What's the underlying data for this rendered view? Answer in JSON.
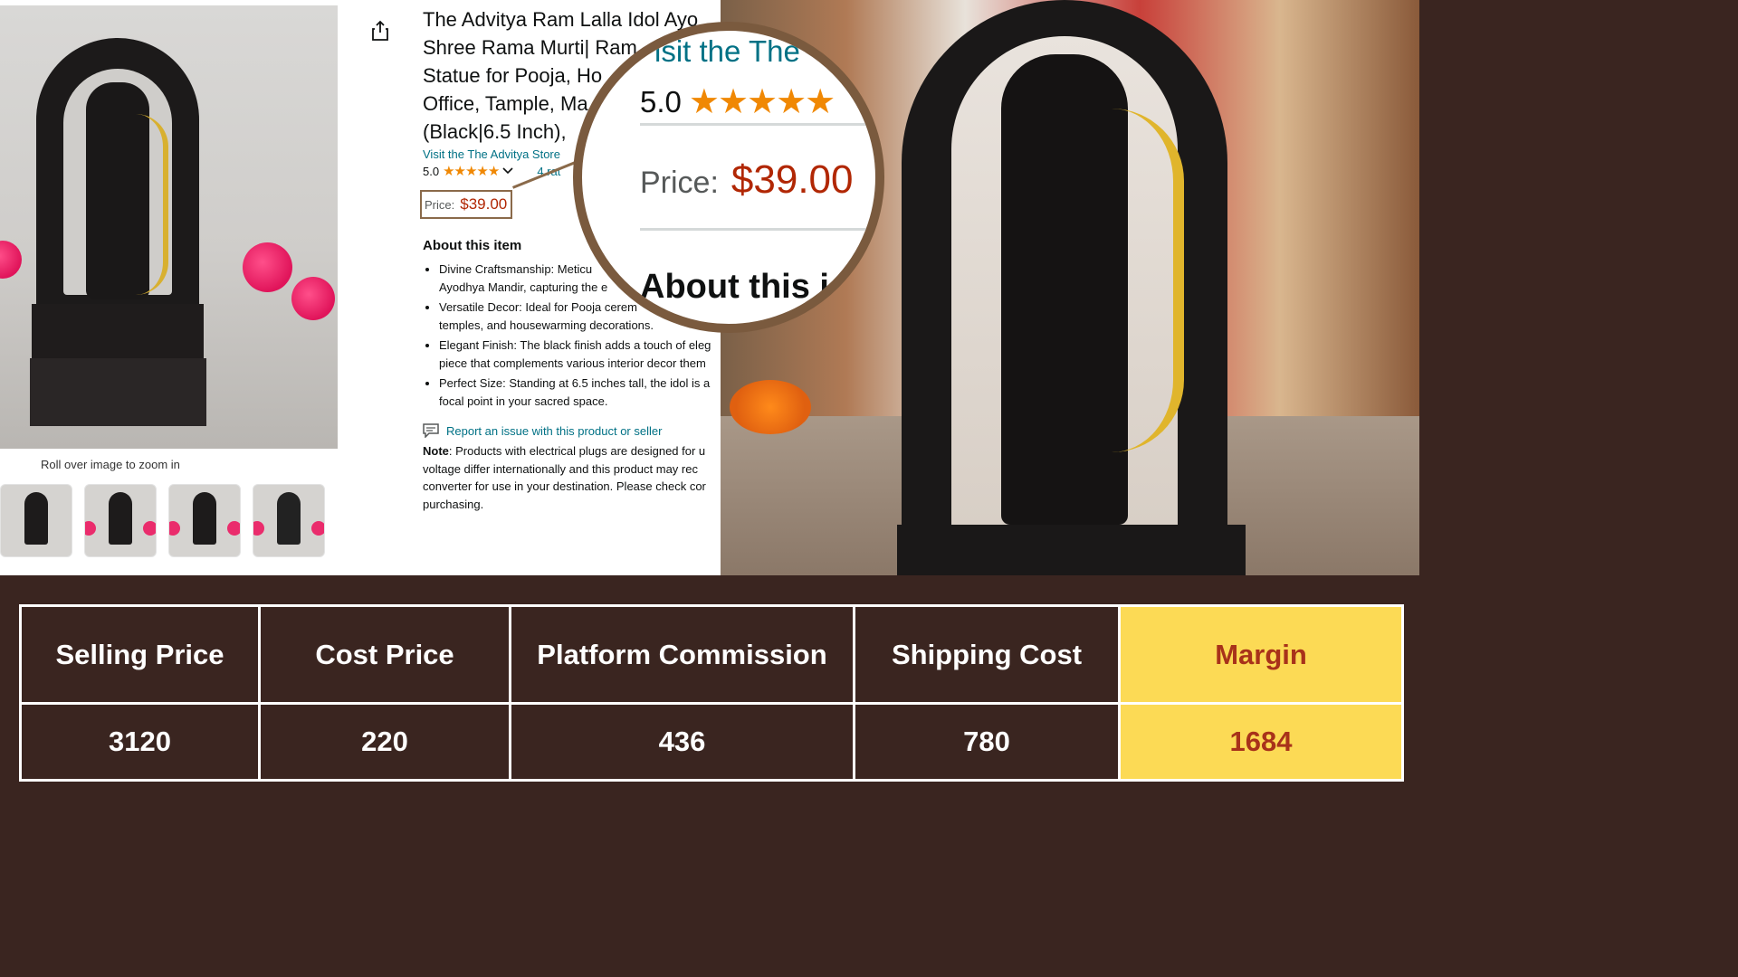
{
  "product": {
    "title_lines": [
      "The Advitya Ram Lalla Idol Ayo",
      "Shree Rama Murti| Ram",
      "Statue for Pooja, Ho",
      "Office, Tample, Ma",
      "(Black|6.5 Inch),"
    ],
    "store_link": "Visit the The Advitya Store",
    "rating": "5.0",
    "stars": "★★★★★",
    "ratings_count": "4 rat",
    "price_label": "Price:",
    "price": "$39.00",
    "about_title": "About this item",
    "bullets": [
      {
        "label": "Divine Craftsmanship:",
        "text": " Meticu",
        "cont": "Ayodhya Mandir, capturing the e"
      },
      {
        "label": "Versatile Decor:",
        "text": " Ideal for Pooja cerem",
        "cont": "temples, and housewarming decorations."
      },
      {
        "label": "Elegant Finish:",
        "text": " The black finish adds a touch of eleg",
        "cont": "piece that complements various interior decor them"
      },
      {
        "label": "Perfect Size:",
        "text": " Standing at 6.5 inches tall, the idol is a",
        "cont": "focal point in your sacred space."
      }
    ],
    "report_link": "Report an issue with this product or seller",
    "note_label": "Note",
    "note_text": ": Products with electrical plugs are designed for u voltage differ internationally and this product may rec converter for use in your destination. Please check cor purchasing.",
    "zoom_hint": "Roll over image to zoom in",
    "thumbnails": 4
  },
  "lens": {
    "store_fragment": "isit the The",
    "rating": "5.0",
    "stars": "★★★★★",
    "price_label": "Price:",
    "price": "$39.00",
    "about_fragment": "About this i"
  },
  "table": {
    "headers": [
      "Selling Price",
      "Cost Price",
      "Platform Commission",
      "Shipping Cost",
      "Margin"
    ],
    "values": [
      "3120",
      "220",
      "436",
      "780",
      "1684"
    ],
    "highlight_color": "#fcda55"
  },
  "colors": {
    "background": "#3a2520",
    "link": "#007185",
    "price": "#b12704",
    "stars": "#f08804"
  }
}
